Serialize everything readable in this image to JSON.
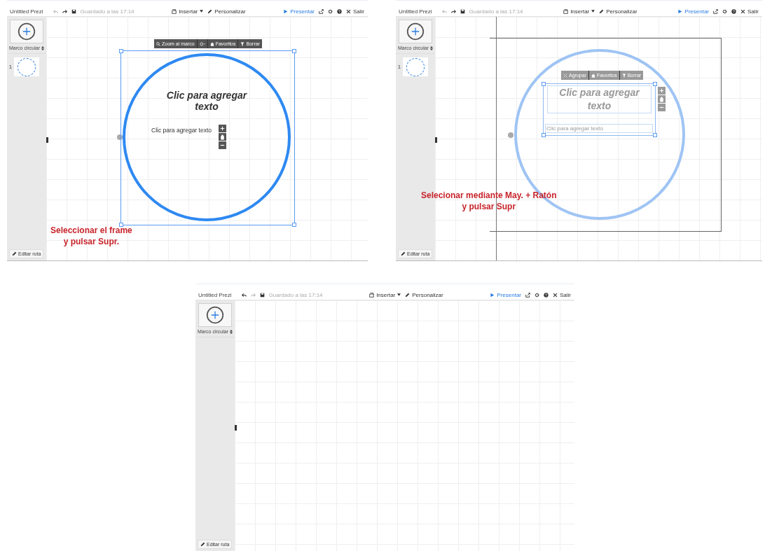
{
  "panels": [
    {
      "toolbar": {
        "title": "Untitled Prezi",
        "undo_enabled": false,
        "redo_enabled": true,
        "saved": "Guardado a las 17:14",
        "insert": "Insertar",
        "customize": "Personalizar",
        "present": "Presentar",
        "exit": "Salir"
      },
      "sidebar": {
        "frame_type": "Marco circular",
        "slides": [
          {
            "number": "1"
          }
        ],
        "edit_path": "Editar ruta"
      },
      "canvas": {
        "frame_selected": true,
        "text_selected": false,
        "title_text": "Clic para agregar texto",
        "body_text": "Clic para agregar texto",
        "toolbar": [
          {
            "kind": "zoom",
            "label": "Zoom al marco"
          },
          {
            "kind": "shape"
          },
          {
            "kind": "favorite",
            "label": "Favoritos"
          },
          {
            "kind": "delete",
            "label": "Borrar"
          }
        ]
      },
      "annotation": [
        "Seleccionar el frame",
        "y pulsar Supr."
      ]
    },
    {
      "toolbar": {
        "title": "Untitled Prezi",
        "undo_enabled": false,
        "redo_enabled": true,
        "saved": "Guardado a las 17:14",
        "insert": "Insertar",
        "customize": "Personalizar",
        "present": "Presentar",
        "exit": "Salir"
      },
      "sidebar": {
        "frame_type": "Marco circular",
        "slides": [
          {
            "number": "1"
          }
        ],
        "edit_path": "Editar ruta"
      },
      "canvas": {
        "frame_selected": false,
        "text_selected": true,
        "outer_frame": true,
        "title_text": "Clic para agregar texto",
        "body_text": "Clic para agregar texto",
        "toolbar": [
          {
            "kind": "group",
            "label": "Agrupar"
          },
          {
            "kind": "favorite",
            "label": "Favoritos"
          },
          {
            "kind": "delete",
            "label": "Borrar"
          }
        ]
      },
      "annotation": [
        "Selecionar mediante May. + Ratón",
        "y pulsar Supr"
      ]
    },
    {
      "toolbar": {
        "title": "Untitled Prezi",
        "undo_enabled": true,
        "redo_enabled": false,
        "saved": "Guardado a las 17:14",
        "insert": "Insertar",
        "customize": "Personalizar",
        "present": "Presentar",
        "exit": "Salir"
      },
      "sidebar": {
        "frame_type": "Marco circular",
        "edit_path": "Editar ruta"
      }
    }
  ]
}
